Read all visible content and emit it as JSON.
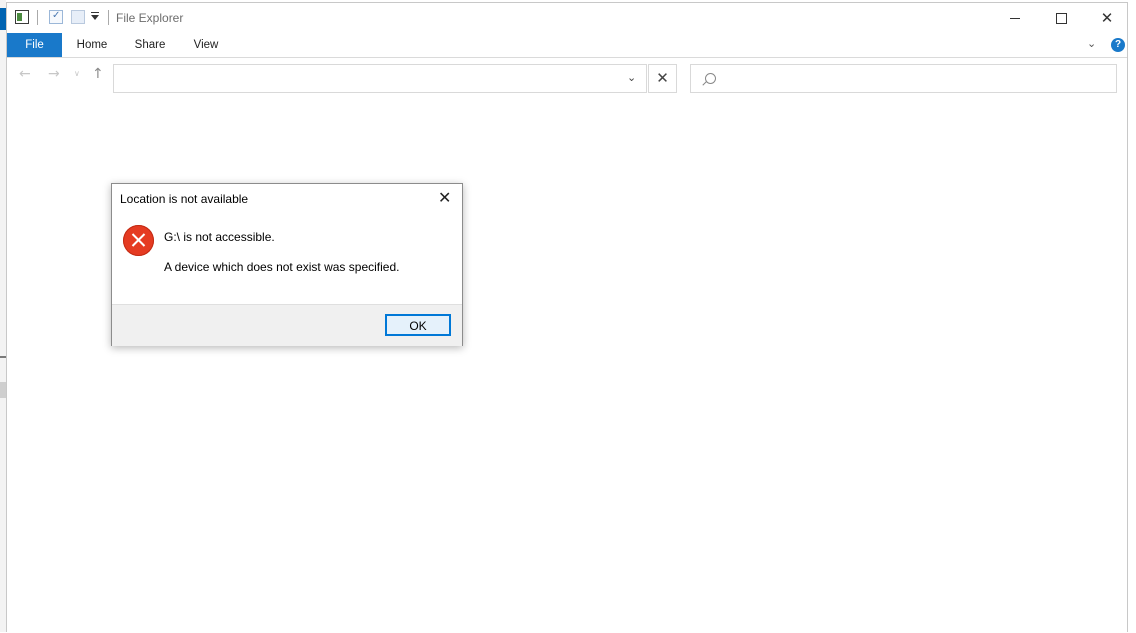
{
  "window": {
    "title": "File Explorer"
  },
  "ribbon": {
    "tabs": [
      "File",
      "Home",
      "Share",
      "View"
    ],
    "help_glyph": "?"
  },
  "navigation": {
    "address_value": "",
    "search_placeholder": ""
  },
  "dialog": {
    "title": "Location is not available",
    "message_primary": "G:\\ is not accessible.",
    "message_secondary": "A device which does not exist was specified.",
    "ok_label": "OK",
    "icon": "error-icon"
  },
  "colors": {
    "accent": "#1979ca",
    "error": "#e53b22",
    "ok_border": "#0078d7"
  }
}
